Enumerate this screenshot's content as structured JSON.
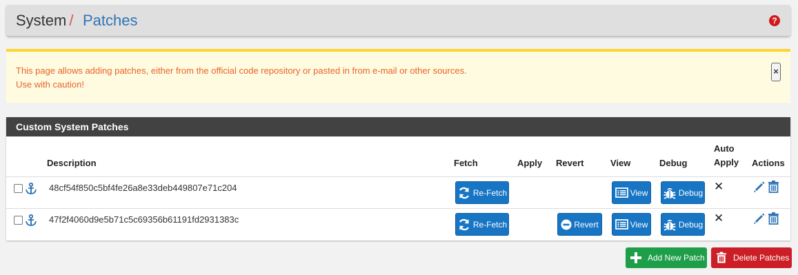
{
  "breadcrumb": {
    "root": "System",
    "separator": "/",
    "current": "Patches"
  },
  "help_icon": "?",
  "alert": {
    "line1": "This page allows adding patches, either from the official code repository or pasted in from e-mail or other sources.",
    "line2": "Use with caution!",
    "close_symbol": "×"
  },
  "panel": {
    "title": "Custom System Patches",
    "columns": {
      "description": "Description",
      "fetch": "Fetch",
      "apply": "Apply",
      "revert": "Revert",
      "view": "View",
      "debug": "Debug",
      "auto_apply_line1": "Auto",
      "auto_apply_line2": "Apply",
      "actions": "Actions"
    },
    "rows": [
      {
        "description": "48cf54f850c5bf4fe26a8e33deb449807e71c204",
        "fetch_label": "Re-Fetch",
        "revert_label": "",
        "view_label": "View",
        "debug_label": "Debug",
        "auto_apply": "✕"
      },
      {
        "description": "47f2f4060d9e5b71c5c69356b61191fd2931383c",
        "fetch_label": "Re-Fetch",
        "revert_label": "Revert",
        "view_label": "View",
        "debug_label": "Debug",
        "auto_apply": "✕"
      }
    ]
  },
  "buttons": {
    "add": "Add New Patch",
    "delete": "Delete Patches"
  },
  "colors": {
    "link_blue": "#2f74b6",
    "alert_text": "#e8632a",
    "button_blue": "#1775c4",
    "button_green": "#1f9e4a",
    "button_red": "#cc1e26"
  },
  "icons": [
    "help-icon",
    "close-icon",
    "anchor-icon",
    "refresh-icon",
    "minus-circle-icon",
    "list-icon",
    "bug-icon",
    "times-icon",
    "pencil-icon",
    "trash-icon",
    "plus-icon"
  ]
}
